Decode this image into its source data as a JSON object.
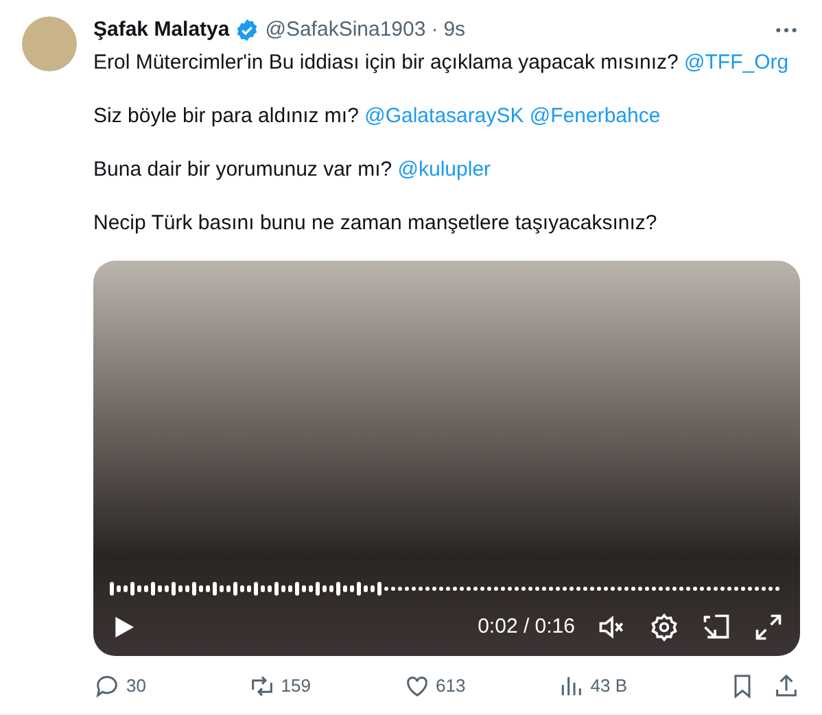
{
  "author": {
    "name": "Şafak Malatya",
    "verified": true,
    "handle": "@SafakSina1903",
    "separator": "·",
    "time": "9s"
  },
  "paragraphs": [
    {
      "parts": [
        {
          "text": "Erol Mütercimler'in Bu iddiası için bir açıklama yapacak mısınız?",
          "kind": "text"
        },
        {
          "text": "@TFF_Org",
          "kind": "mention"
        }
      ]
    },
    {
      "parts": [
        {
          "text": "Siz böyle bir para aldınız mı?",
          "kind": "text"
        },
        {
          "text": "@GalatasaraySK",
          "kind": "mention"
        },
        {
          "text": "@Fenerbahce",
          "kind": "mention"
        }
      ]
    },
    {
      "parts": [
        {
          "text": "Buna dair bir yorumunuz var mı?",
          "kind": "text"
        },
        {
          "text": "@kulupler",
          "kind": "mention"
        }
      ]
    },
    {
      "parts": [
        {
          "text": "Necip Türk basını bunu ne zaman manşetlere taşıyacaksınız?",
          "kind": "text"
        }
      ]
    }
  ],
  "video": {
    "time": "0:02 / 0:16",
    "muted": true
  },
  "actions": [
    {
      "kind": "reply",
      "count": "30"
    },
    {
      "kind": "repost",
      "count": "159"
    },
    {
      "kind": "like",
      "count": "613"
    },
    {
      "kind": "views",
      "count": "43 B"
    },
    {
      "kind": "bookmark"
    },
    {
      "kind": "share"
    }
  ]
}
